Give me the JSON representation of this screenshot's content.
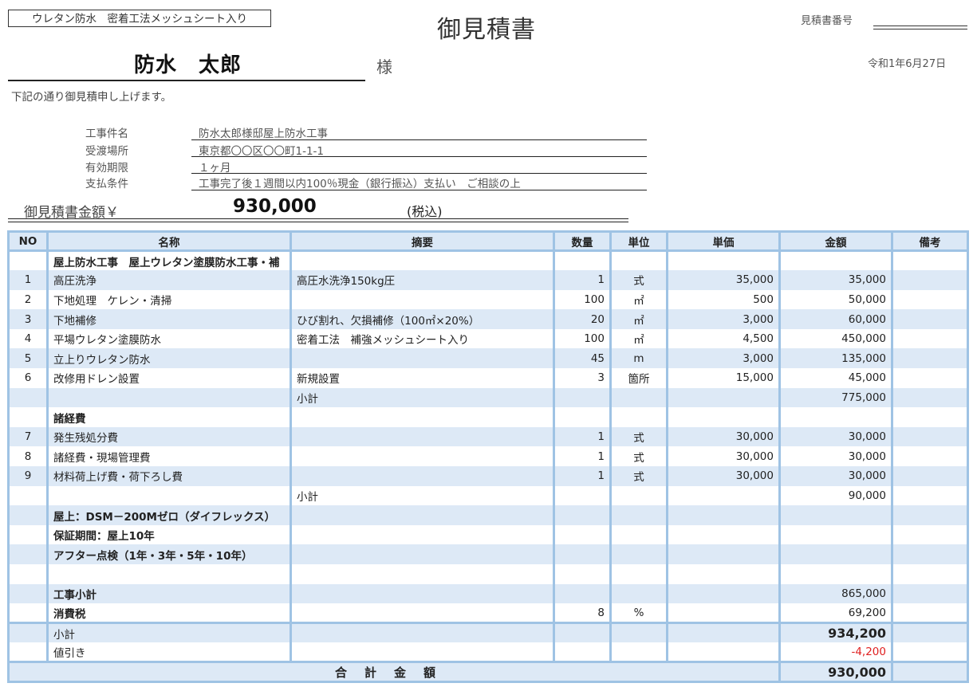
{
  "header": {
    "tag": "ウレタン防水　密着工法メッシュシート入り",
    "title": "御見積書",
    "estimate_number_label": "見積書番号",
    "client": "防水　太郎",
    "honorific": "様",
    "date": "令和1年6月27日",
    "intro": "下記の通り御見積申し上げます。"
  },
  "info": {
    "project_label": "工事件名",
    "project_value": "防水太郎様邸屋上防水工事",
    "location_label": "受渡場所",
    "location_value": "東京都〇〇区〇〇町1-1-1",
    "validity_label": "有効期限",
    "validity_value": "１ヶ月",
    "payment_label": "支払条件",
    "payment_value": "工事完了後１週間以内100％現金（銀行振込）支払い　ご相談の上"
  },
  "total": {
    "label": "御見積書金額￥",
    "value": "930,000",
    "tax": "(税込)"
  },
  "table": {
    "headers": [
      "NO",
      "名称",
      "摘要",
      "数量",
      "単位",
      "単価",
      "金額",
      "備考"
    ],
    "rows": [
      {
        "no": "",
        "name": "屋上防水工事　屋上ウレタン塗膜防水工事・補",
        "desc": "",
        "qty": "",
        "unit": "",
        "price": "",
        "amount": "",
        "note": ""
      },
      {
        "no": "1",
        "name": "高圧洗浄",
        "desc": "高圧水洗浄150kg圧",
        "qty": "1",
        "unit": "式",
        "price": "35,000",
        "amount": "35,000",
        "note": ""
      },
      {
        "no": "2",
        "name": "下地処理　ケレン・清掃",
        "desc": "",
        "qty": "100",
        "unit": "㎡",
        "price": "500",
        "amount": "50,000",
        "note": ""
      },
      {
        "no": "3",
        "name": "下地補修",
        "desc": "ひび割れ、欠損補修（100㎡×20%）",
        "qty": "20",
        "unit": "㎡",
        "price": "3,000",
        "amount": "60,000",
        "note": ""
      },
      {
        "no": "4",
        "name": "平場ウレタン塗膜防水",
        "desc": "密着工法　補強メッシュシート入り",
        "qty": "100",
        "unit": "㎡",
        "price": "4,500",
        "amount": "450,000",
        "note": ""
      },
      {
        "no": "5",
        "name": "立上りウレタン防水",
        "desc": "",
        "qty": "45",
        "unit": "m",
        "price": "3,000",
        "amount": "135,000",
        "note": ""
      },
      {
        "no": "6",
        "name": "改修用ドレン設置",
        "desc": "新規設置",
        "qty": "3",
        "unit": "箇所",
        "price": "15,000",
        "amount": "45,000",
        "note": ""
      },
      {
        "no": "",
        "name": "",
        "desc": "小計",
        "qty": "",
        "unit": "",
        "price": "",
        "amount": "775,000",
        "note": ""
      },
      {
        "no": "",
        "name": "諸経費",
        "desc": "",
        "qty": "",
        "unit": "",
        "price": "",
        "amount": "",
        "note": ""
      },
      {
        "no": "7",
        "name": "発生残処分費",
        "desc": "",
        "qty": "1",
        "unit": "式",
        "price": "30,000",
        "amount": "30,000",
        "note": ""
      },
      {
        "no": "8",
        "name": "諸経費・現場管理費",
        "desc": "",
        "qty": "1",
        "unit": "式",
        "price": "30,000",
        "amount": "30,000",
        "note": ""
      },
      {
        "no": "9",
        "name": "材料荷上げ費・荷下ろし費",
        "desc": "",
        "qty": "1",
        "unit": "式",
        "price": "30,000",
        "amount": "30,000",
        "note": ""
      },
      {
        "no": "",
        "name": "",
        "desc": "小計",
        "qty": "",
        "unit": "",
        "price": "",
        "amount": "90,000",
        "note": ""
      },
      {
        "no": "",
        "name": "屋上：DSM－200Mゼロ（ダイフレックス）",
        "desc": "",
        "qty": "",
        "unit": "",
        "price": "",
        "amount": "",
        "note": ""
      },
      {
        "no": "",
        "name": "保証期間：屋上10年",
        "desc": "",
        "qty": "",
        "unit": "",
        "price": "",
        "amount": "",
        "note": ""
      },
      {
        "no": "",
        "name": "アフター点検（1年・3年・5年・10年）",
        "desc": "",
        "qty": "",
        "unit": "",
        "price": "",
        "amount": "",
        "note": ""
      },
      {
        "no": "",
        "name": "",
        "desc": "",
        "qty": "",
        "unit": "",
        "price": "",
        "amount": "",
        "note": ""
      },
      {
        "no": "",
        "name": "工事小計",
        "desc": "",
        "qty": "",
        "unit": "",
        "price": "",
        "amount": "865,000",
        "note": ""
      },
      {
        "no": "",
        "name": "消費税",
        "desc": "",
        "qty": "8",
        "unit": "%",
        "price": "",
        "amount": "69,200",
        "note": ""
      }
    ],
    "subtotal_label": "小計",
    "subtotal_value": "934,200",
    "discount_label": "値引き",
    "discount_value": "-4,200",
    "grand_total_label": "合計金額",
    "grand_total_value": "930,000"
  },
  "colors": {
    "grid_border": "#9fc3e4",
    "row_shade": "#dde9f6",
    "negative": "#e02020"
  }
}
